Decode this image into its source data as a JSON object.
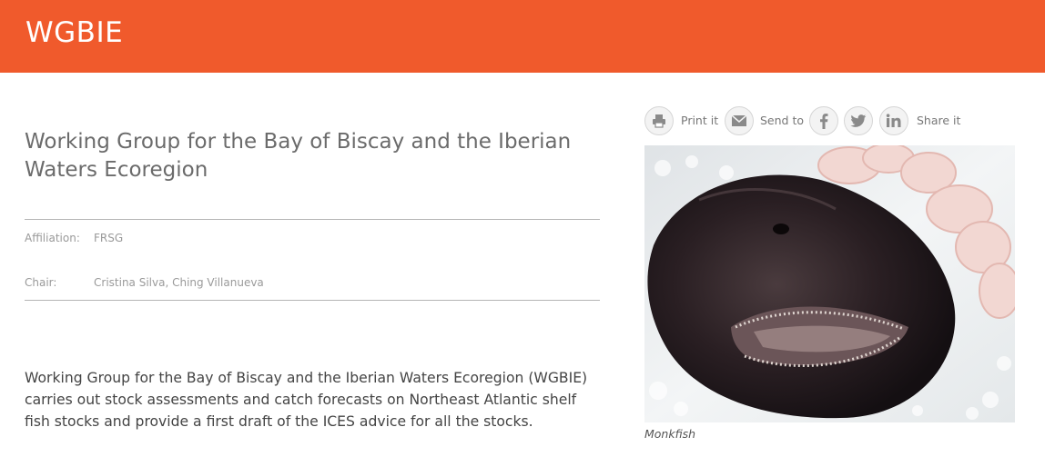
{
  "header": {
    "title": "WGBIE"
  },
  "main": {
    "title": "Working Group for the Bay of Biscay and the Iberian Waters Ecoregion",
    "meta": {
      "affiliation_label": "Affiliation:",
      "affiliation_value": "FRSG",
      "chair_label": "Chair:",
      "chair_value": "Cristina Silva, Ching Villanueva"
    },
    "description": "Working Group for the Bay of Biscay and the Iberian Waters Ecoregion (WGBIE) carries out stock assessments and catch forecasts on Northeast Atlantic shelf fish stocks and provide a first draft of the ICES advice for all the stocks."
  },
  "share": {
    "print_label": "Print it",
    "send_label": "Send to",
    "share_label": "Share it",
    "icons": [
      "printer-icon",
      "envelope-icon",
      "facebook-icon",
      "twitter-icon",
      "linkedin-icon"
    ]
  },
  "image": {
    "caption": "Monkfish",
    "subject": "monkfish on ice"
  },
  "colors": {
    "banner": "#f05a2c",
    "title_text": "#6b6b6b",
    "icon_bg": "#f3f3f3"
  }
}
